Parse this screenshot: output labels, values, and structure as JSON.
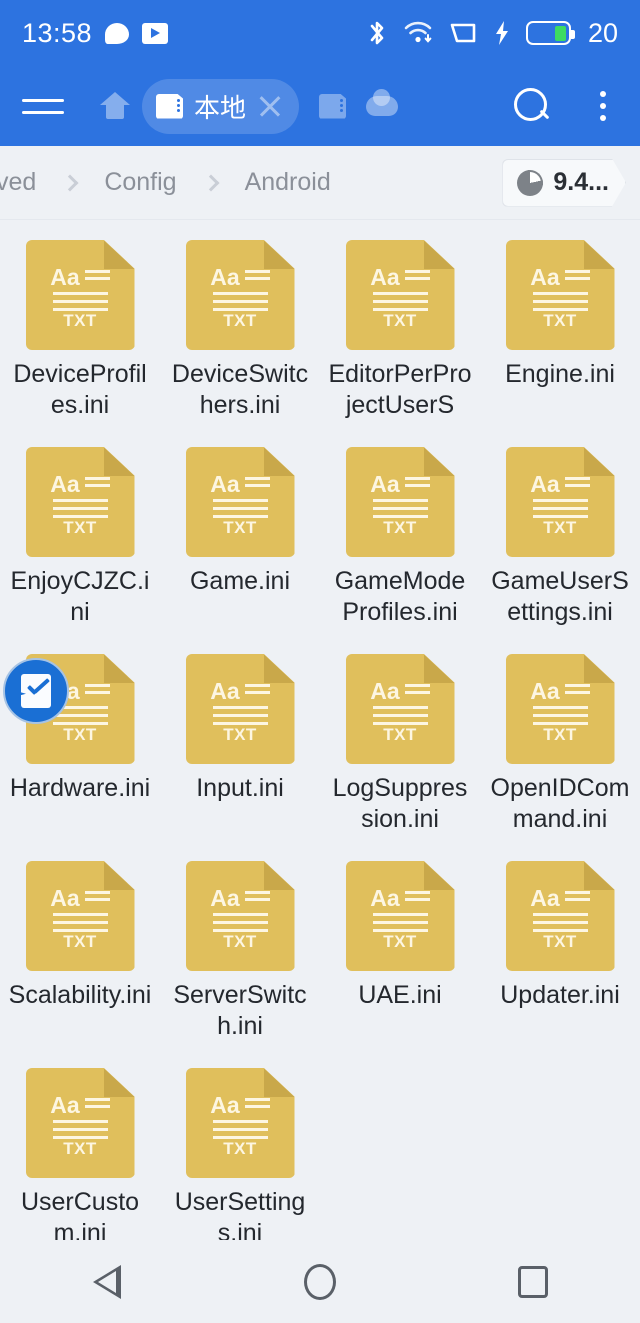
{
  "status_bar": {
    "time": "13:58",
    "left_icons": [
      "chat-bubble-icon",
      "video-play-icon"
    ],
    "right_icons": [
      "bluetooth-icon",
      "wifi-icon",
      "sim-signal-icon",
      "charging-bolt-icon"
    ],
    "battery_percent": "20",
    "background_color": "#2d73e0"
  },
  "toolbar": {
    "menu_icon": "hamburger-menu-icon",
    "home_icon": "home-icon",
    "active_tab": {
      "icon": "sd-card-icon",
      "label": "本地",
      "close_icon": "close-x-icon"
    },
    "inactive_tabs": [
      {
        "icon": "sd-card-icon"
      },
      {
        "icon": "cloud-icon"
      }
    ],
    "search_icon": "search-icon",
    "overflow_icon": "kebab-menu-icon"
  },
  "breadcrumb": {
    "items": [
      "ved",
      "Config",
      "Android"
    ],
    "separator_icon": "chevron-right-icon",
    "storage_chip": {
      "icon": "pie-chart-icon",
      "label": "9.4..."
    }
  },
  "files": [
    {
      "name": "DeviceProfiles.ini",
      "type": "TXT",
      "selected": false
    },
    {
      "name": "DeviceSwitchers.ini",
      "type": "TXT",
      "selected": false
    },
    {
      "name": "EditorPerProjectUserS",
      "type": "TXT",
      "selected": false
    },
    {
      "name": "Engine.ini",
      "type": "TXT",
      "selected": false
    },
    {
      "name": "EnjoyCJZC.ini",
      "type": "TXT",
      "selected": false
    },
    {
      "name": "Game.ini",
      "type": "TXT",
      "selected": false
    },
    {
      "name": "GameModeProfiles.ini",
      "type": "TXT",
      "selected": false
    },
    {
      "name": "GameUserSettings.ini",
      "type": "TXT",
      "selected": false
    },
    {
      "name": "Hardware.ini",
      "type": "TXT",
      "selected": true
    },
    {
      "name": "Input.ini",
      "type": "TXT",
      "selected": false
    },
    {
      "name": "LogSuppression.ini",
      "type": "TXT",
      "selected": false
    },
    {
      "name": "OpenIDCommand.ini",
      "type": "TXT",
      "selected": false
    },
    {
      "name": "Scalability.ini",
      "type": "TXT",
      "selected": false
    },
    {
      "name": "ServerSwitch.ini",
      "type": "TXT",
      "selected": false
    },
    {
      "name": "UAE.ini",
      "type": "TXT",
      "selected": false
    },
    {
      "name": "Updater.ini",
      "type": "TXT",
      "selected": false
    },
    {
      "name": "UserCustom.ini",
      "type": "TXT",
      "selected": false
    },
    {
      "name": "UserSettings.ini",
      "type": "TXT",
      "selected": false
    }
  ],
  "icon_glyph": {
    "sample_text": "Aa"
  },
  "nav_bar": {
    "back_icon": "back-triangle-icon",
    "home_icon": "home-circle-icon",
    "recents_icon": "recents-square-icon"
  },
  "colors": {
    "accent": "#2d73e0",
    "file_icon": "#e0bf5c",
    "file_icon_fold": "#c9a84a",
    "background": "#eef1f5",
    "selection_badge": "#1a6fd4",
    "battery_fill": "#3ddb62"
  }
}
